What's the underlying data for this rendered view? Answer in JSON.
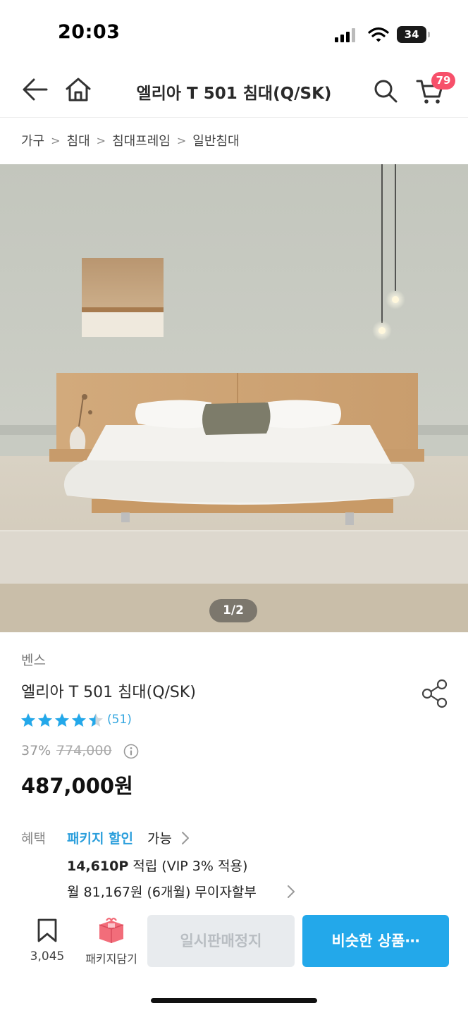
{
  "status_bar": {
    "time": "20:03",
    "battery": "34"
  },
  "header": {
    "title": "엘리아 T 501 침대(Q/SK)",
    "cart_count": "79"
  },
  "breadcrumb": [
    "가구",
    "침대",
    "침대프레임",
    "일반침대"
  ],
  "gallery": {
    "counter": "1/2"
  },
  "product": {
    "brand": "벤스",
    "name": "엘리아 T 501 침대(Q/SK)",
    "rating": 4.5,
    "review_count": "(51)",
    "discount": "37%",
    "original_price": "774,000",
    "price": "487,000원"
  },
  "benefits": {
    "label": "혜택",
    "package_link": "패키지 할인",
    "package_suffix": "가능",
    "points_amount": "14,610P",
    "points_text": "적립 (VIP 3% 적용)",
    "installment": "월 81,167원 (6개월) 무이자할부"
  },
  "bottom_bar": {
    "bookmark_count": "3,045",
    "package_cart_label": "패키지담기",
    "soldout_label": "일시판매정지",
    "similar_label": "비슷한 상품⋯"
  },
  "colors": {
    "accent": "#23a8ea",
    "badge": "#f7506a"
  }
}
